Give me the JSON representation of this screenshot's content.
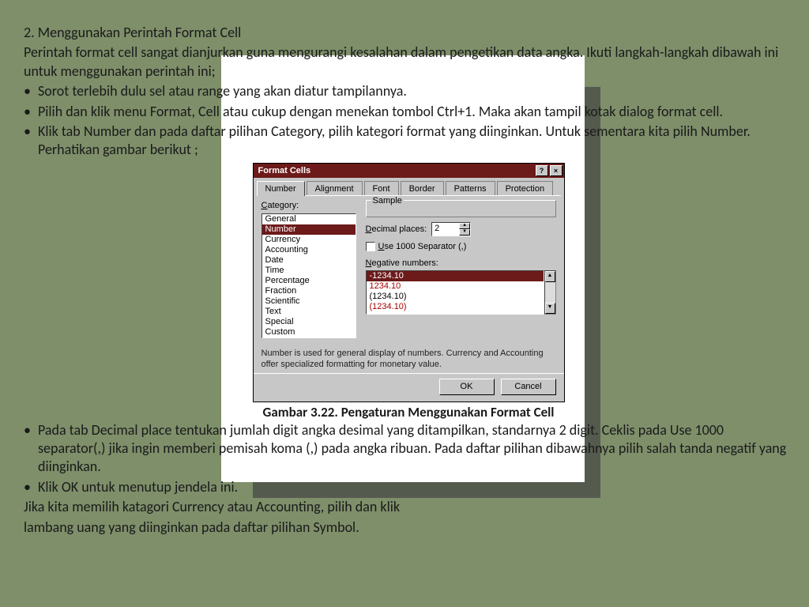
{
  "doc": {
    "heading": "2. Menggunakan Perintah Format Cell",
    "intro": "Perintah format cell sangat dianjurkan guna mengurangi kesalahan dalam pengetikan data angka. Ikuti langkah-langkah dibawah ini untuk menggunakan perintah ini;",
    "bullets_a": [
      "Sorot terlebih dulu sel atau range yang akan diatur tampilannya.",
      "Pilih dan klik menu Format, Cell atau cukup dengan menekan tombol Ctrl+1. Maka akan tampil kotak dialog format cell.",
      "Klik tab Number dan pada daftar pilihan Category, pilih kategori format yang diinginkan. Untuk sementara kita pilih Number. Perhatikan gambar berikut ;"
    ],
    "caption": "Gambar 3.22. Pengaturan Menggunakan Format Cell",
    "bullets_b": [
      "Pada tab Decimal place tentukan jumlah digit angka desimal yang ditampilkan, standarnya 2 digit. Ceklis pada Use 1000 separator(,) jika ingin memberi pemisah koma (,) pada angka ribuan. Pada daftar pilihan dibawahnya pilih salah tanda negatif yang diinginkan.",
      "Klik OK untuk menutup jendela ini."
    ],
    "outro1": "Jika kita memilih katagori Currency atau Accounting, pilih dan klik",
    "outro2": "lambang uang yang diinginkan pada daftar pilihan Symbol."
  },
  "dialog": {
    "title": "Format Cells",
    "tabs": [
      "Number",
      "Alignment",
      "Font",
      "Border",
      "Patterns",
      "Protection"
    ],
    "category_label": "Category:",
    "categories": [
      "General",
      "Number",
      "Currency",
      "Accounting",
      "Date",
      "Time",
      "Percentage",
      "Fraction",
      "Scientific",
      "Text",
      "Special",
      "Custom"
    ],
    "category_selected": "Number",
    "sample_label": "Sample",
    "decimal_label": "Decimal places:",
    "decimal_value": "2",
    "separator_label": "Use 1000 Separator (,)",
    "negative_label": "Negative numbers:",
    "negative_numbers": [
      "-1234.10",
      "1234.10",
      "(1234.10)",
      "(1234.10)"
    ],
    "negative_selected_index": 0,
    "hint": "Number is used for general display of numbers.  Currency and Accounting offer specialized formatting for monetary value.",
    "ok": "OK",
    "cancel": "Cancel"
  }
}
